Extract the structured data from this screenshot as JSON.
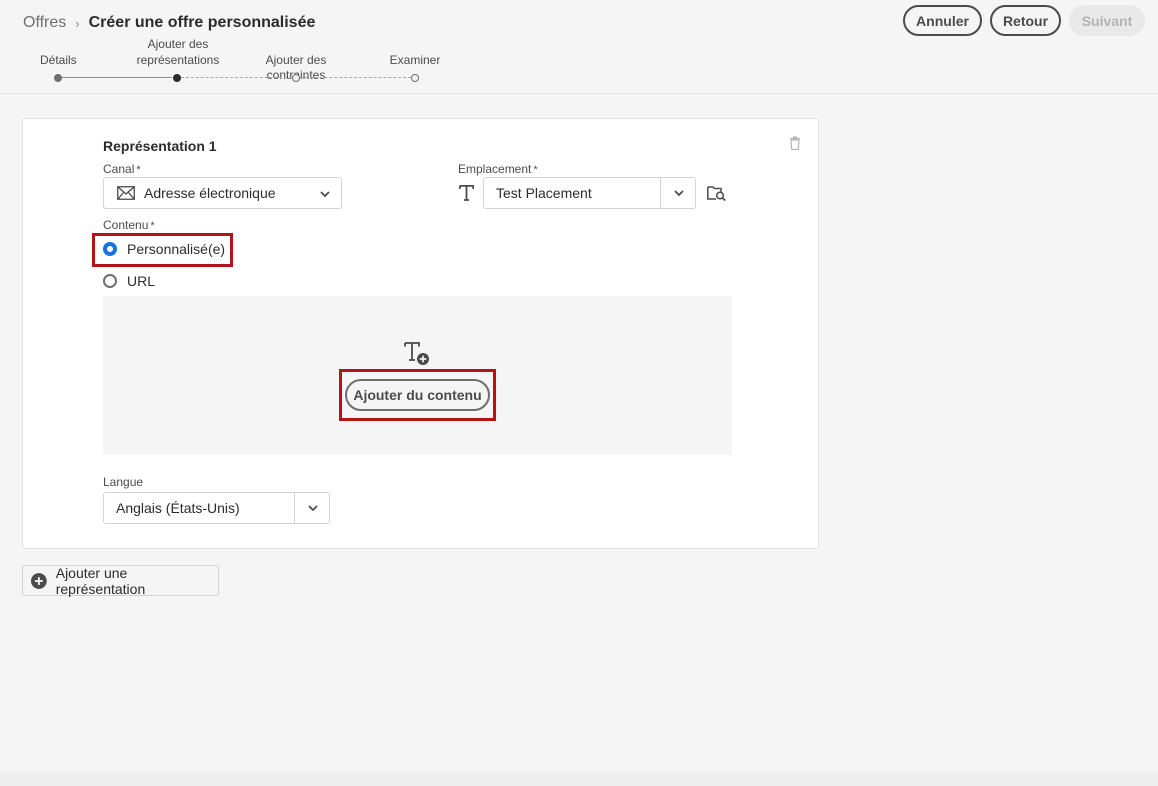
{
  "breadcrumb": {
    "root": "Offres",
    "separator": "›",
    "title": "Créer une offre personnalisée"
  },
  "header_buttons": {
    "cancel": "Annuler",
    "back": "Retour",
    "next": "Suivant"
  },
  "steps": [
    {
      "label": "Détails",
      "state": "done"
    },
    {
      "label_line1": "Ajouter des",
      "label_line2": "représentations",
      "state": "current"
    },
    {
      "label": "Ajouter des contraintes",
      "state": "todo"
    },
    {
      "label": "Examiner",
      "state": "todo"
    }
  ],
  "representation": {
    "title": "Représentation 1",
    "channel_label": "Canal",
    "channel_value": "Adresse électronique",
    "placement_label": "Emplacement",
    "placement_value": "Test Placement",
    "content_label": "Contenu",
    "required_mark": "*",
    "content_options": [
      {
        "label": "Personnalisé(e)",
        "selected": true
      },
      {
        "label": "URL",
        "selected": false
      }
    ],
    "add_content_label": "Ajouter du contenu",
    "language_label": "Langue",
    "language_value": "Anglais (États-Unis)"
  },
  "add_representation_label": "Ajouter une représentation",
  "colors": {
    "accent_blue": "#1473e6",
    "highlight_red": "#b5121b"
  },
  "icons": [
    "chevron-right-icon",
    "envelope-icon",
    "chevron-down-icon",
    "text-icon",
    "folder-search-icon",
    "trash-icon",
    "text-add-icon",
    "plus-circle-icon"
  ]
}
